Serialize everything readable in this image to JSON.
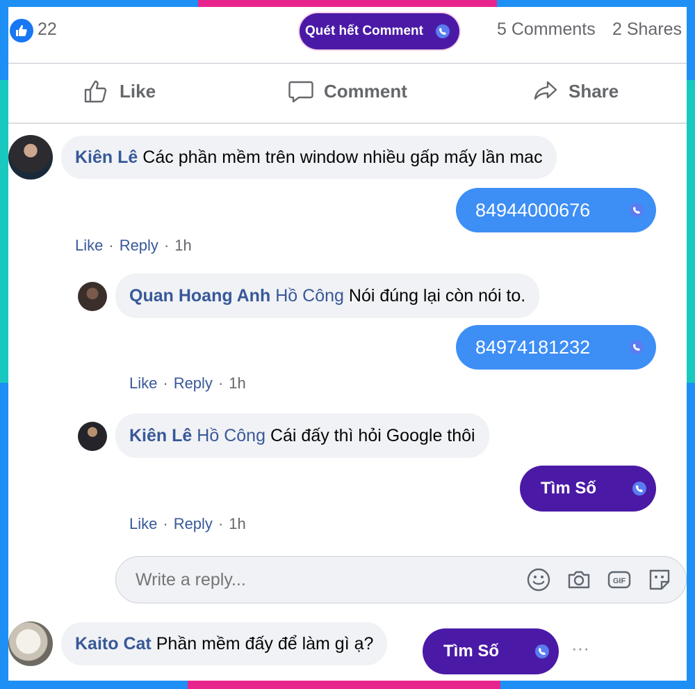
{
  "post_stats": {
    "like_count": "22",
    "scan_button": "Quét hết Comment",
    "comments": "5 Comments",
    "shares": "2 Shares"
  },
  "actions": {
    "like": "Like",
    "comment": "Comment",
    "share": "Share"
  },
  "comments": [
    {
      "author": "Kiên Lê",
      "text": "Các phần mềm trên window nhiều gấp mấy lần mac",
      "phone_button": "84944000676",
      "meta": {
        "like": "Like",
        "reply": "Reply",
        "time": "1h"
      }
    },
    {
      "author": "Quan Hoang Anh",
      "tag": "Hồ Công",
      "text": "Nói đúng lại còn nói to.",
      "phone_button": "84974181232",
      "meta": {
        "like": "Like",
        "reply": "Reply",
        "time": "1h"
      }
    },
    {
      "author": "Kiên Lê",
      "tag": "Hồ Công",
      "text": "Cái đấy thì hỏi Google thôi",
      "find_button": "Tìm Số",
      "meta": {
        "like": "Like",
        "reply": "Reply",
        "time": "1h"
      }
    },
    {
      "author": "Kaito Cat",
      "text": "Phần mềm đấy để làm gì ạ?",
      "find_button": "Tìm Số",
      "more": "···"
    }
  ],
  "reply_box": {
    "placeholder": "Write a reply..."
  },
  "colors": {
    "facebook_blue": "#1877f2",
    "phone_pill": "#3d8ef5",
    "find_pill": "#4a1aa6",
    "name_link": "#385898",
    "frame_blue": "#1e90f5",
    "frame_pink": "#e8258f",
    "frame_teal": "#19c9c0"
  }
}
